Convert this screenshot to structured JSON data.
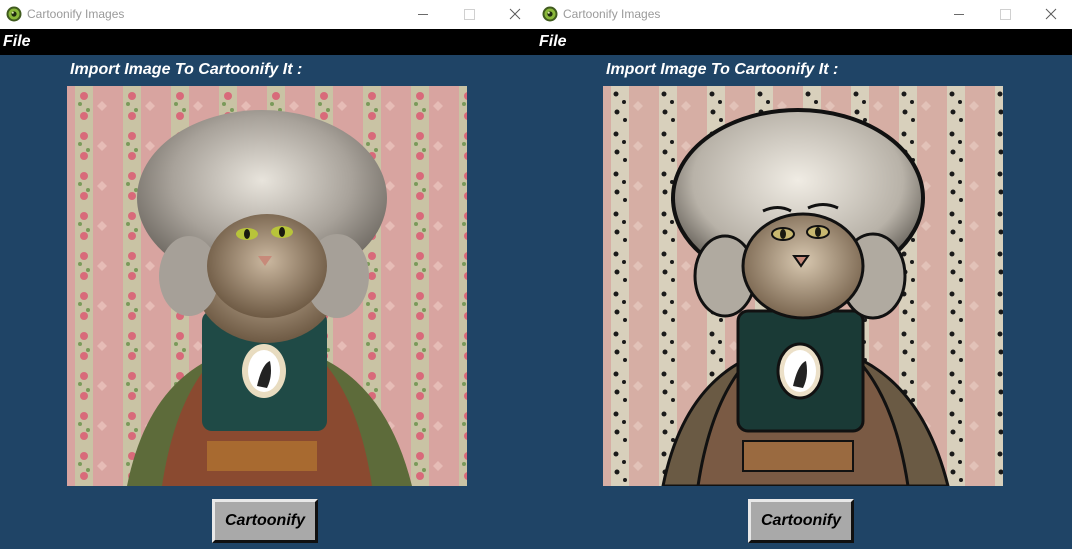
{
  "windows": [
    {
      "title": "Cartoonify Images",
      "menu": {
        "file_label": "File"
      },
      "prompt": "Import Image To Cartoonify It :",
      "image": {
        "description": "Original photo of a cat in a large silver wig and Victorian costume",
        "style": "original"
      },
      "button_label": "Cartoonify"
    },
    {
      "title": "Cartoonify Images",
      "menu": {
        "file_label": "File"
      },
      "prompt": "Import Image To Cartoonify It :",
      "image": {
        "description": "Cartoonified version of the cat portrait with dark edge outlines",
        "style": "cartoon"
      },
      "button_label": "Cartoonify"
    }
  ],
  "colors": {
    "window_bg": "#1f4466",
    "menubar_bg": "#000000",
    "button_bg": "#a9a9a9",
    "text_light": "#ffffff"
  },
  "icons": {
    "app": "green-eye-icon",
    "minimize": "minimize-icon",
    "maximize": "maximize-icon",
    "close": "close-icon"
  }
}
